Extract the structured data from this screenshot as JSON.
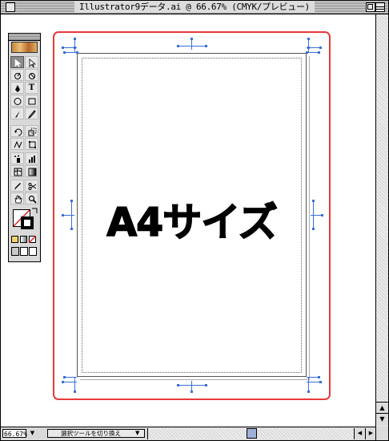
{
  "window": {
    "title": "Illustrator9データ.ai @ 66.67% (CMYK/プレビュー)"
  },
  "document": {
    "page_label": "A4サイズ",
    "artboard_color": "#e63a3a",
    "crop_mark_color": "#3a6fd8"
  },
  "toolbox": {
    "tools": [
      {
        "icon": "selection-arrow-icon",
        "selected": true
      },
      {
        "icon": "direct-selection-icon",
        "selected": false
      },
      {
        "icon": "twirl-icon",
        "selected": false
      },
      {
        "icon": "reshape-icon",
        "selected": false
      },
      {
        "icon": "pen-icon",
        "selected": false
      },
      {
        "icon": "type-icon",
        "glyph": "T",
        "selected": false
      },
      {
        "icon": "ellipse-icon",
        "selected": false
      },
      {
        "icon": "rectangle-icon",
        "selected": false
      },
      {
        "icon": "paintbrush-icon",
        "selected": false
      },
      {
        "icon": "pencil-icon",
        "selected": false
      },
      {
        "icon": "rotate-icon",
        "selected": false
      },
      {
        "icon": "scale-icon",
        "selected": false
      },
      {
        "icon": "warp-icon",
        "selected": false
      },
      {
        "icon": "free-transform-icon",
        "selected": false
      },
      {
        "icon": "symbol-sprayer-icon",
        "selected": false
      },
      {
        "icon": "graph-icon",
        "selected": false
      },
      {
        "icon": "mesh-icon",
        "selected": false
      },
      {
        "icon": "gradient-icon",
        "selected": false
      },
      {
        "icon": "eyedropper-icon",
        "selected": false
      },
      {
        "icon": "scissors-icon",
        "selected": false
      },
      {
        "icon": "hand-icon",
        "selected": false
      },
      {
        "icon": "zoom-icon",
        "selected": false
      }
    ]
  },
  "status": {
    "zoom": "66.67%",
    "tool_status": "選択ツールを切り換え"
  }
}
